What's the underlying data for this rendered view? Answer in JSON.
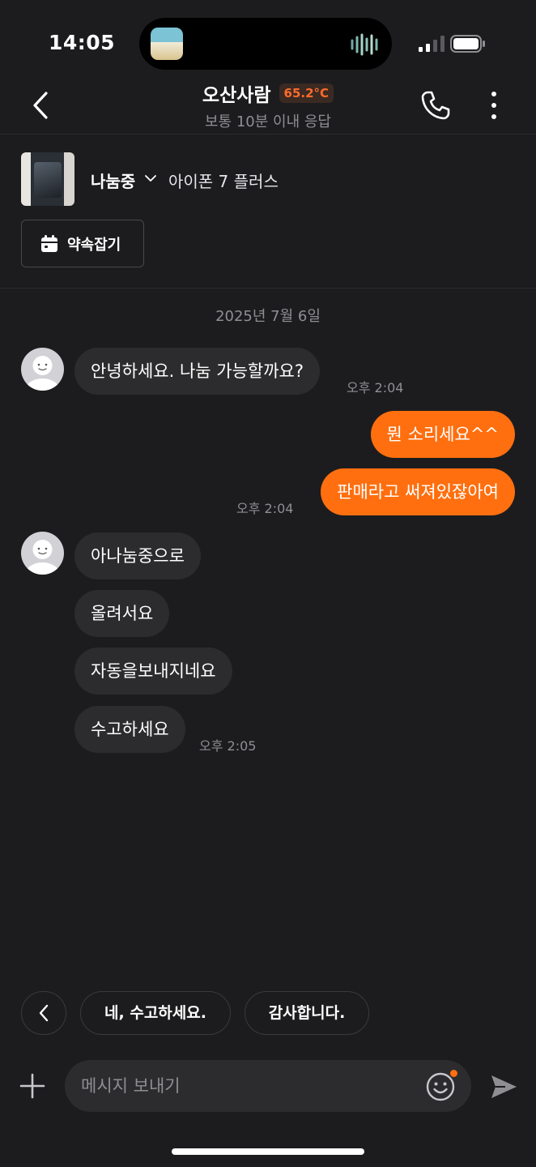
{
  "status_bar": {
    "time": "14:05"
  },
  "header": {
    "name": "오산사람",
    "temperature": "65.2°C",
    "response_time": "보통 10분 이내 응답"
  },
  "product": {
    "status": "나눔중",
    "title": "아이폰 7 플러스",
    "appointment_label": "약속잡기"
  },
  "chat": {
    "date": "2025년 7월 6일",
    "messages": [
      {
        "from": "other",
        "text": "안녕하세요. 나눔 가능할까요?",
        "time": "오후 2:04"
      },
      {
        "from": "me",
        "text": "뭔 소리세요^^"
      },
      {
        "from": "me",
        "text": "판매라고 써져있잖아여",
        "time": "오후 2:04"
      },
      {
        "from": "other",
        "text": "아나눔중으로"
      },
      {
        "from": "other",
        "text": "올려서요"
      },
      {
        "from": "other",
        "text": "자동을보내지네요"
      },
      {
        "from": "other",
        "text": "수고하세요",
        "time": "오후 2:05"
      }
    ]
  },
  "quick_replies": [
    "네, 수고하세요.",
    "감사합니다."
  ],
  "input": {
    "placeholder": "메시지 보내기"
  },
  "colors": {
    "accent": "#ff6f0f",
    "background": "#1c1c1e",
    "bubble_in": "#2c2c2e",
    "temperature": "#ff6b2c"
  }
}
